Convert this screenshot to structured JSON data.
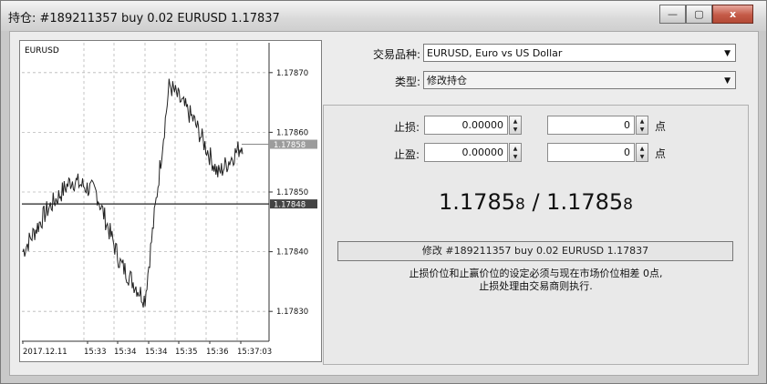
{
  "window": {
    "title": "持仓: #189211357 buy 0.02 EURUSD 1.17837",
    "controls": {
      "minimize": "—",
      "maximize": "▢",
      "close": "x"
    }
  },
  "chart": {
    "symbol": "EURUSD",
    "price_labels": [
      "1.17870",
      "1.17860",
      "1.17850",
      "1.17840",
      "1.17830"
    ],
    "tag_ask": "1.17858",
    "tag_bid": "1.17848",
    "time_labels": [
      "2017.12.11",
      "15:33",
      "15:34",
      "15:34",
      "15:35",
      "15:36",
      "15:37:03"
    ],
    "colors": {
      "tag_ask_bg": "#9c9c9c",
      "tag_bid_bg": "#444444",
      "grid": "#b8b8b8"
    }
  },
  "chart_data": {
    "type": "line",
    "title": "EURUSD",
    "xlabel": "",
    "ylabel": "",
    "ylim": [
      1.17825,
      1.17875
    ],
    "x": [
      "2017.12.11",
      "15:33",
      "15:34",
      "15:34",
      "15:35",
      "15:36",
      "15:37:03"
    ],
    "series": [
      {
        "values": [
          1.1784,
          1.17847,
          1.17852,
          1.1785,
          1.17838,
          1.17832,
          1.17868,
          1.17862,
          1.17853,
          1.17858
        ]
      }
    ],
    "lines": {
      "ask": 1.17858,
      "bid": 1.17848
    }
  },
  "form": {
    "symbol_label": "交易品种:",
    "symbol_value": "EURUSD, Euro vs US Dollar",
    "type_label": "类型:",
    "type_value": "修改持仓",
    "sl_label": "止损:",
    "sl_value": "0.00000",
    "sl_points": "0",
    "tp_label": "止盈:",
    "tp_value": "0.00000",
    "tp_points": "0",
    "points_unit": "点",
    "bid_main": "1.1785",
    "bid_small": "8",
    "sep": " / ",
    "ask_main": "1.1785",
    "ask_small": "8",
    "modify_button": "修改 #189211357 buy 0.02 EURUSD 1.17837",
    "note_line1": "止损价位和止赢价位的设定必须与现在市场价位相差 0点,",
    "note_line2": "止损处理由交易商则执行."
  }
}
